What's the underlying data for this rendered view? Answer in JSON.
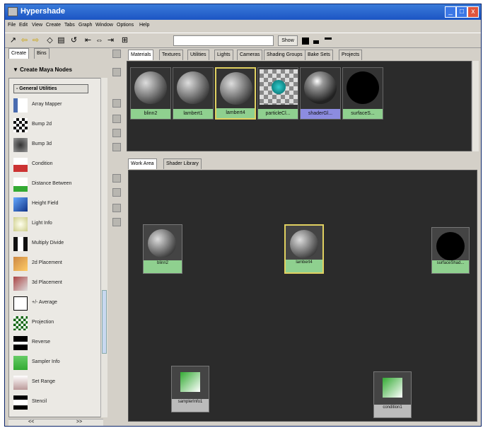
{
  "window": {
    "title": "Hypershade",
    "minimize": "_",
    "maximize": "□",
    "close": "x"
  },
  "menu": [
    "File",
    "Edit",
    "View",
    "Create",
    "Tabs",
    "Graph",
    "Window",
    "Options",
    "Help"
  ],
  "toolbar": {
    "show_label": "Show",
    "search_value": ""
  },
  "left_panel": {
    "tabs": [
      "Create",
      "Bins"
    ],
    "create_header": "Create Maya Nodes",
    "section": "General Utilities",
    "nodes": [
      {
        "label": "Array Mapper",
        "icon": "array-mapper-icon"
      },
      {
        "label": "Bump 2d",
        "icon": "bump-2d-icon"
      },
      {
        "label": "Bump 3d",
        "icon": "bump-3d-icon"
      },
      {
        "label": "Condition",
        "icon": "condition-icon"
      },
      {
        "label": "Distance Between",
        "icon": "distance-between-icon"
      },
      {
        "label": "Height Field",
        "icon": "height-field-icon"
      },
      {
        "label": "Light Info",
        "icon": "light-info-icon"
      },
      {
        "label": "Multiply Divide",
        "icon": "multiply-divide-icon"
      },
      {
        "label": "2d Placement",
        "icon": "placement-2d-icon"
      },
      {
        "label": "3d Placement",
        "icon": "placement-3d-icon"
      },
      {
        "label": "+/- Average",
        "icon": "plus-minus-average-icon"
      },
      {
        "label": "Projection",
        "icon": "projection-icon"
      },
      {
        "label": "Reverse",
        "icon": "reverse-icon"
      },
      {
        "label": "Sampler Info",
        "icon": "sampler-info-icon"
      },
      {
        "label": "Set Range",
        "icon": "set-range-icon"
      },
      {
        "label": "Stencil",
        "icon": "stencil-icon"
      }
    ],
    "hscroll_left": "<<",
    "hscroll_right": ">>"
  },
  "material_tabs": [
    "Materials",
    "Textures",
    "Utilities",
    "Lights",
    "Cameras",
    "Shading Groups",
    "Bake Sets",
    "Projects"
  ],
  "materials": [
    {
      "name": "blinn2",
      "kind": "gray"
    },
    {
      "name": "lambert1",
      "kind": "gray"
    },
    {
      "name": "lambert4",
      "kind": "gray",
      "selected": true
    },
    {
      "name": "particleCl...",
      "kind": "checker"
    },
    {
      "name": "shaderGl...",
      "kind": "shiny"
    },
    {
      "name": "surfaceS...",
      "kind": "black"
    }
  ],
  "work_tabs": [
    "Work Area",
    "Shader Library"
  ],
  "work_nodes": [
    {
      "name": "blinn2",
      "kind": "gray"
    },
    {
      "name": "lambert4",
      "kind": "gray"
    },
    {
      "name": "surfaceShad...",
      "kind": "black"
    },
    {
      "name": "samplerInfo1",
      "kind": "util"
    },
    {
      "name": "condition1",
      "kind": "util"
    }
  ]
}
